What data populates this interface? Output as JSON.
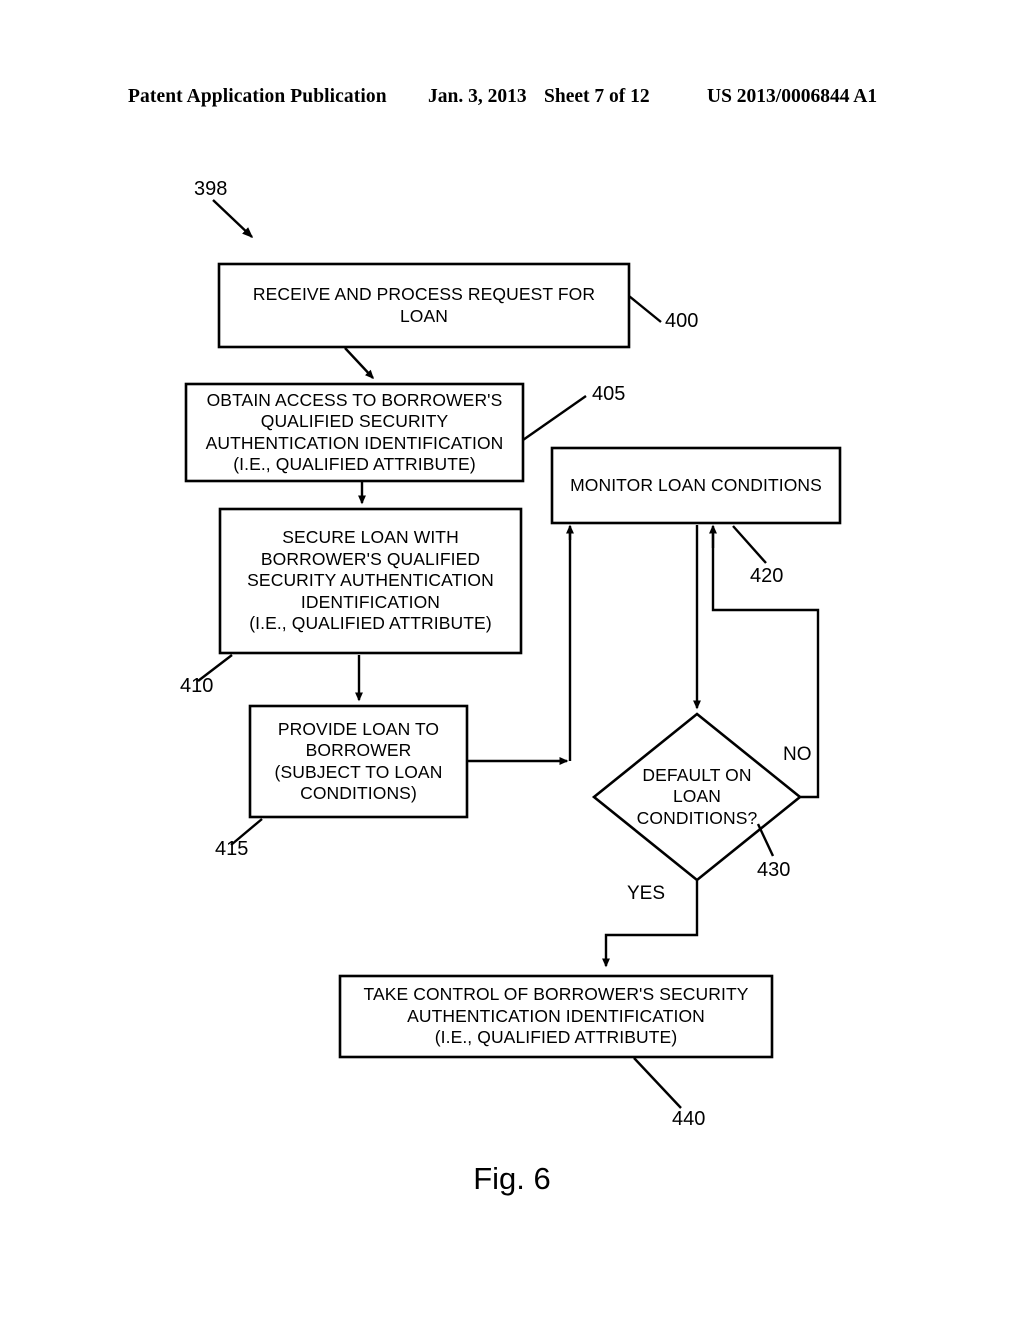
{
  "header": {
    "publication": "Patent Application Publication",
    "date": "Jan. 3, 2013",
    "sheet": "Sheet 7 of 12",
    "patent_number": "US 2013/0006844 A1"
  },
  "figure": {
    "caption": "Fig. 6",
    "diagram_ref": "398"
  },
  "nodes": {
    "n400": {
      "ref": "400",
      "lines": [
        "RECEIVE AND PROCESS REQUEST FOR",
        "LOAN"
      ]
    },
    "n405": {
      "ref": "405",
      "lines": [
        "OBTAIN ACCESS TO BORROWER'S",
        "QUALIFIED SECURITY",
        "AUTHENTICATION IDENTIFICATION",
        "(I.E., QUALIFIED ATTRIBUTE)"
      ]
    },
    "n410": {
      "ref": "410",
      "lines": [
        "SECURE LOAN WITH",
        "BORROWER'S QUALIFIED",
        "SECURITY AUTHENTICATION",
        "IDENTIFICATION",
        "(I.E., QUALIFIED ATTRIBUTE)"
      ]
    },
    "n415": {
      "ref": "415",
      "lines": [
        "PROVIDE LOAN TO",
        "BORROWER",
        "(SUBJECT TO LOAN",
        "CONDITIONS)"
      ]
    },
    "n420": {
      "ref": "420",
      "lines": [
        "MONITOR LOAN CONDITIONS"
      ]
    },
    "n430": {
      "ref": "430",
      "lines": [
        "DEFAULT ON",
        "LOAN",
        "CONDITIONS?"
      ]
    },
    "n440": {
      "ref": "440",
      "lines": [
        "TAKE CONTROL OF BORROWER'S SECURITY",
        "AUTHENTICATION IDENTIFICATION",
        "(I.E., QUALIFIED ATTRIBUTE)"
      ]
    }
  },
  "branches": {
    "yes": "YES",
    "no": "NO"
  },
  "colors": {
    "stroke": "#000000",
    "background": "#ffffff",
    "text": "#000000"
  }
}
